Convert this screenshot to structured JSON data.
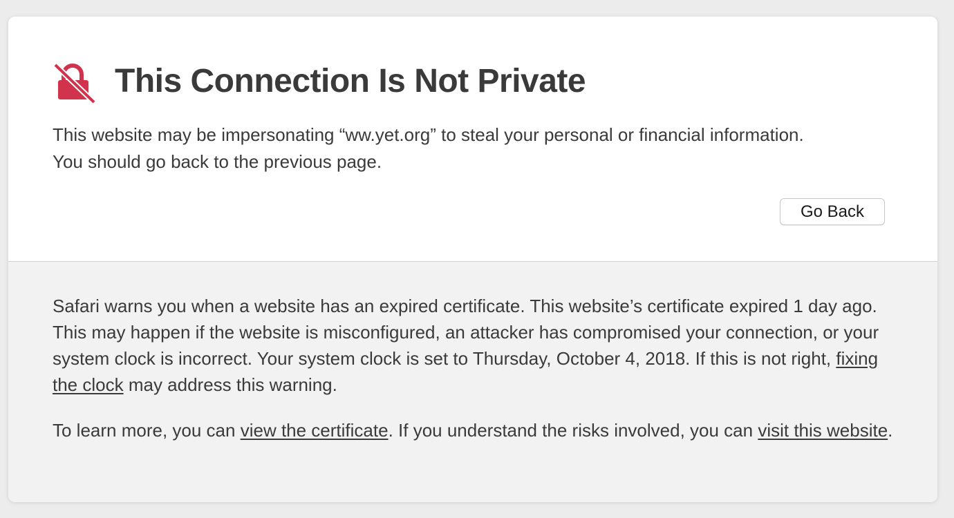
{
  "page": {
    "title": "This Connection Is Not Private",
    "intro": "This website may be impersonating “ww.yet.org” to steal your personal or financial information. You should go back to the previous page.",
    "go_back_label": "Go Back",
    "icon": "broken-lock-icon",
    "accent_color": "#d0334b"
  },
  "details": {
    "para1_start": "Safari warns you when a website has an expired certificate. This website’s certificate expired 1 day ago. This may happen if the website is misconfigured, an attacker has compromised your connection, or your system clock is incorrect. Your system clock is set to Thursday, October 4, 2018. If this is not right, ",
    "fix_clock_link": "fixing the clock",
    "para1_end": " may address this warning.",
    "para2_start": "To learn more, you can ",
    "view_cert_link": "view the certificate",
    "para2_mid": ". If you understand the risks involved, you can ",
    "visit_site_link": "visit this website",
    "para2_end": "."
  }
}
